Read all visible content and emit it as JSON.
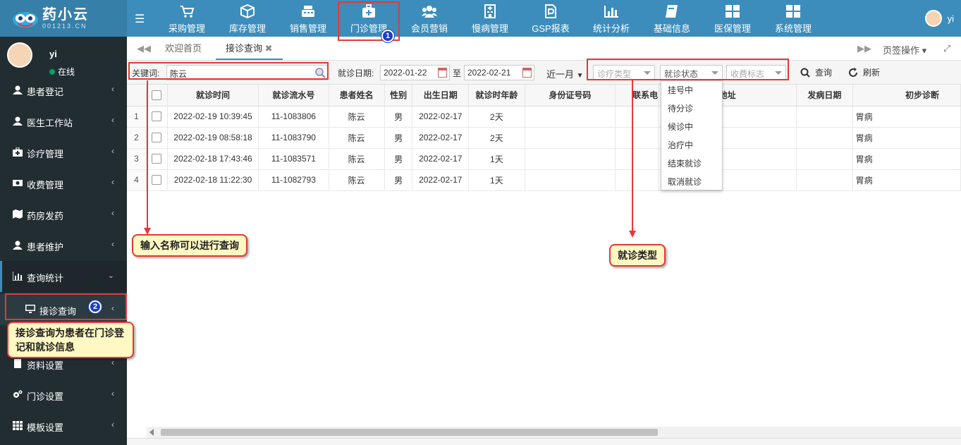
{
  "app": {
    "logo_main": "药小云",
    "logo_sub": "001213.CN",
    "user_name": "yi"
  },
  "topnav": [
    {
      "label": "采购管理",
      "icon": "cart-icon"
    },
    {
      "label": "库存管理",
      "icon": "box-icon"
    },
    {
      "label": "销售管理",
      "icon": "register-icon"
    },
    {
      "label": "门诊管理",
      "icon": "medical-kit-icon"
    },
    {
      "label": "会员营销",
      "icon": "users-icon"
    },
    {
      "label": "慢病管理",
      "icon": "hospital-icon"
    },
    {
      "label": "GSP报表",
      "icon": "file-p-icon"
    },
    {
      "label": "统计分析",
      "icon": "bar-chart-icon"
    },
    {
      "label": "基础信息",
      "icon": "book-icon"
    },
    {
      "label": "医保管理",
      "icon": "windows-icon"
    },
    {
      "label": "系统管理",
      "icon": "windows-icon"
    }
  ],
  "sidebar": {
    "user_name": "yi",
    "status": "在线",
    "items": [
      {
        "label": "患者登记"
      },
      {
        "label": "医生工作站"
      },
      {
        "label": "诊疗管理"
      },
      {
        "label": "收费管理"
      },
      {
        "label": "药房发药"
      },
      {
        "label": "患者维护"
      },
      {
        "label": "查询统计"
      },
      {
        "label": "接诊查询"
      },
      {
        "label": "资料设置"
      },
      {
        "label": "门诊设置"
      },
      {
        "label": "模板设置"
      }
    ]
  },
  "tabs": {
    "home": "欢迎首页",
    "current": "接诊查询",
    "page_ops": "页签操作"
  },
  "toolbar": {
    "keyword_label": "关键词:",
    "keyword_value": "陈云",
    "date_label": "就诊日期:",
    "date_from": "2022-01-22",
    "to_label": "至",
    "date_to": "2022-02-21",
    "period": "近一月",
    "visit_type_placeholder": "诊疗类型",
    "visit_status_placeholder": "就诊状态",
    "fee_flag_placeholder": "收费标志",
    "search_label": "查询",
    "refresh_label": "刷新"
  },
  "table": {
    "columns": [
      "就诊时间",
      "就诊流水号",
      "患者姓名",
      "性别",
      "出生日期",
      "就诊时年龄",
      "身份证号码",
      "联系电",
      "地址",
      "发病日期",
      "初步诊断"
    ],
    "rows": [
      {
        "num": "1",
        "time": "2022-02-19 10:39:45",
        "serial": "11-1083806",
        "name": "陈云",
        "sex": "男",
        "birth": "2022-02-17",
        "age": "2天",
        "diag": "胃病"
      },
      {
        "num": "2",
        "time": "2022-02-19 08:58:18",
        "serial": "11-1083790",
        "name": "陈云",
        "sex": "男",
        "birth": "2022-02-17",
        "age": "2天",
        "diag": "胃病"
      },
      {
        "num": "3",
        "time": "2022-02-18 17:43:46",
        "serial": "11-1083571",
        "name": "陈云",
        "sex": "男",
        "birth": "2022-02-17",
        "age": "1天",
        "diag": "胃病"
      },
      {
        "num": "4",
        "time": "2022-02-18 11:22:30",
        "serial": "11-1082793",
        "name": "陈云",
        "sex": "男",
        "birth": "2022-02-17",
        "age": "1天",
        "diag": "胃病"
      }
    ]
  },
  "dropdown": {
    "options": [
      "挂号中",
      "待分诊",
      "候诊中",
      "治疗中",
      "结束就诊",
      "取消就诊"
    ]
  },
  "annotations": {
    "badge1": "1",
    "badge2": "2",
    "callout_keyword": "输入名称可以进行查询",
    "callout_type": "就诊类型",
    "callout_query": "接诊查询为患者在门诊登记和就诊信息"
  },
  "colors": {
    "header_blue": "#3c8dbc",
    "sidebar_dark": "#222d32",
    "annotation_red": "#e53935",
    "callout_yellow": "#fff8c2"
  }
}
